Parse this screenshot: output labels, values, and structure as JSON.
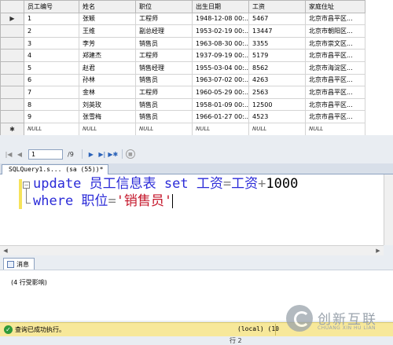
{
  "grid": {
    "columns": [
      "员工编号",
      "姓名",
      "职位",
      "出生日期",
      "工资",
      "家庭住址"
    ],
    "rows": [
      [
        "1",
        "张颖",
        "工程师",
        "1948-12-08 00:...",
        "5467",
        "北京市昌平区..."
      ],
      [
        "2",
        "王维",
        "副总经理",
        "1953-02-19 00:...",
        "13447",
        "北京市朝阳区..."
      ],
      [
        "3",
        "李芳",
        "销售员",
        "1963-08-30 00:...",
        "3355",
        "北京市崇文区..."
      ],
      [
        "4",
        "郑建杰",
        "工程师",
        "1937-09-19 00:...",
        "5179",
        "北京市昌平区..."
      ],
      [
        "5",
        "赵君",
        "销售经理",
        "1955-03-04 00:...",
        "8562",
        "北京市海淀区..."
      ],
      [
        "6",
        "孙林",
        "销售员",
        "1963-07-02 00:...",
        "4263",
        "北京市昌平区..."
      ],
      [
        "7",
        "金林",
        "工程师",
        "1960-05-29 00:...",
        "2563",
        "北京市昌平区..."
      ],
      [
        "8",
        "刘英玫",
        "销售员",
        "1958-01-09 00:...",
        "12500",
        "北京市昌平区..."
      ],
      [
        "9",
        "张雪梅",
        "销售员",
        "1966-01-27 00:...",
        "4523",
        "北京市昌平区..."
      ]
    ],
    "null_text": "NULL",
    "current_row_marker": "▶",
    "new_row_marker": "✱"
  },
  "navigator": {
    "page_value": "1",
    "page_count": "/9"
  },
  "query_tab": {
    "label": "SQLQuery1.s... (sa (55))*"
  },
  "editor": {
    "line1": {
      "kw1": "update",
      "table": " 员工信息表 ",
      "kw2": "set",
      "col": " 工资",
      "eq": "=",
      "col2": "工资",
      "plus": "+",
      "num": "1000"
    },
    "line2": {
      "kw": "where",
      "col": " 职位",
      "eq": "=",
      "str": "'销售员'"
    }
  },
  "messages": {
    "tab_label": "消息",
    "text": "(4 行受影响)"
  },
  "status": {
    "text": "查询已成功执行。",
    "server": "(local) (10",
    "row_indicator": "行 2"
  },
  "watermark": {
    "cn": "创新互联",
    "en": "CHUANG XIN HU LIAN"
  },
  "colors": {
    "keyword": "#2b2bd8",
    "string": "#c4162a",
    "status_bg": "#f7e89a",
    "ok": "#2e9a3a"
  }
}
